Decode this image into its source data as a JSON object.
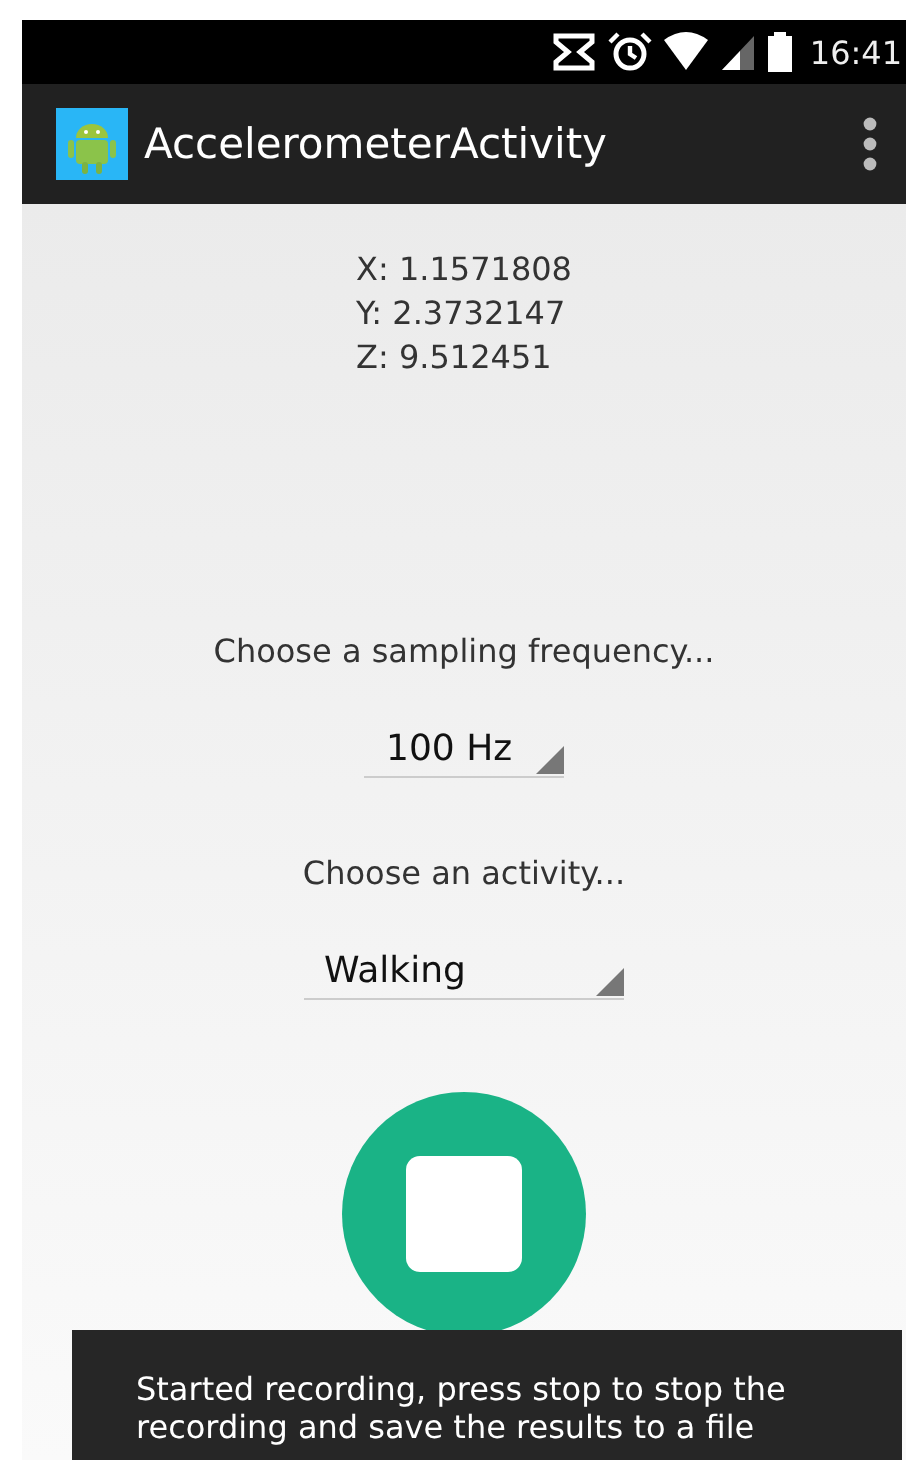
{
  "status_bar": {
    "time": "16:41"
  },
  "app_bar": {
    "title": "AccelerometerActivity"
  },
  "readings": [
    "X: 1.1571808",
    "Y: 2.3732147",
    "Z: 9.512451"
  ],
  "frequency": {
    "label": "Choose a sampling frequency...",
    "value": "100 Hz"
  },
  "activity": {
    "label": "Choose an activity...",
    "value": "Walking"
  },
  "toast": {
    "message": "Started recording, press stop to stop the recording and save the results to a file"
  }
}
